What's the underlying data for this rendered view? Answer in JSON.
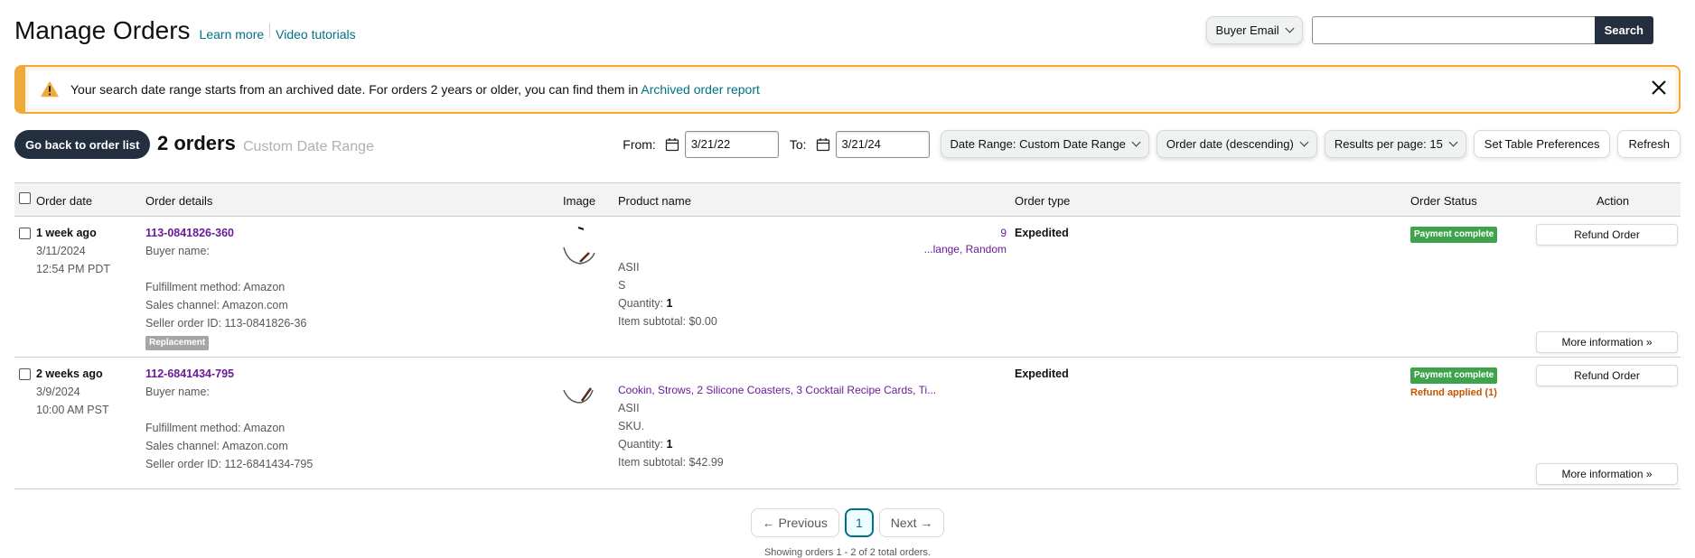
{
  "header": {
    "title": "Manage Orders",
    "learn_more": "Learn more",
    "video_tutorials": "Video tutorials"
  },
  "search": {
    "filter_label": "Buyer Email",
    "placeholder": "",
    "button": "Search"
  },
  "alert": {
    "text": "Your search date range starts from an archived date. For orders 2 years or older, you can find them in ",
    "link": "Archived order report"
  },
  "toolbar": {
    "back_button": "Go back to order list",
    "orders_count": "2 orders",
    "orders_sub": "Custom Date Range",
    "from_label": "From:",
    "from_value": "3/21/22",
    "to_label": "To:",
    "to_value": "3/21/24",
    "date_range": "Date Range: Custom Date Range",
    "sort": "Order date (descending)",
    "per_page": "Results per page: 15",
    "table_prefs": "Set Table Preferences",
    "refresh": "Refresh"
  },
  "table": {
    "columns": {
      "order_date": "Order date",
      "order_details": "Order details",
      "image": "Image",
      "product_name": "Product name",
      "order_type": "Order type",
      "order_status": "Order Status",
      "action": "Action"
    },
    "rows": [
      {
        "relative": "1 week ago",
        "date": "3/11/2024",
        "time": "12:54 PM PDT",
        "order_id": "113-0841826-360",
        "buyer_name": "Buyer name:",
        "fulfillment": "Fulfillment method: Amazon",
        "channel": "Sales channel: Amazon.com",
        "seller_order": "Seller order ID: 113-0841826-36",
        "tag": "Replacement",
        "product_line_a": "9",
        "product_line_b": "...lange, Random",
        "asin": "ASII",
        "sku": "S",
        "quantity_label": "Quantity: ",
        "quantity": "1",
        "subtotal": "Item subtotal: $0.00",
        "order_type": "Expedited",
        "status": "Payment complete",
        "status_extra": "",
        "refund_button": "Refund Order",
        "more_info": "More information"
      },
      {
        "relative": "2 weeks ago",
        "date": "3/9/2024",
        "time": "10:00 AM PST",
        "order_id": "112-6841434-795",
        "buyer_name": "Buyer name:",
        "fulfillment": "Fulfillment method: Amazon",
        "channel": "Sales channel: Amazon.com",
        "seller_order": "Seller order ID: 112-6841434-795",
        "tag": "",
        "product_line_a": "",
        "product_line_b": "Cookin, Strows, 2 Silicone Coasters, 3 Cocktail Recipe Cards, Ti...",
        "asin": "ASII",
        "sku": "SKU.",
        "quantity_label": "Quantity: ",
        "quantity": "1",
        "subtotal": "Item subtotal: $42.99",
        "order_type": "Expedited",
        "status": "Payment complete",
        "status_extra": "Refund applied (1)",
        "refund_button": "Refund Order",
        "more_info": "More information"
      }
    ]
  },
  "pagination": {
    "previous": "← Previous",
    "current": "1",
    "next": "Next →",
    "showing": "Showing orders 1 - 2 of 2 total orders."
  },
  "colors": {
    "accent": "#007185",
    "dark": "#232f3e",
    "warning": "#f0a93b",
    "success": "#3fa34d",
    "order_link": "#6a1b9a"
  }
}
